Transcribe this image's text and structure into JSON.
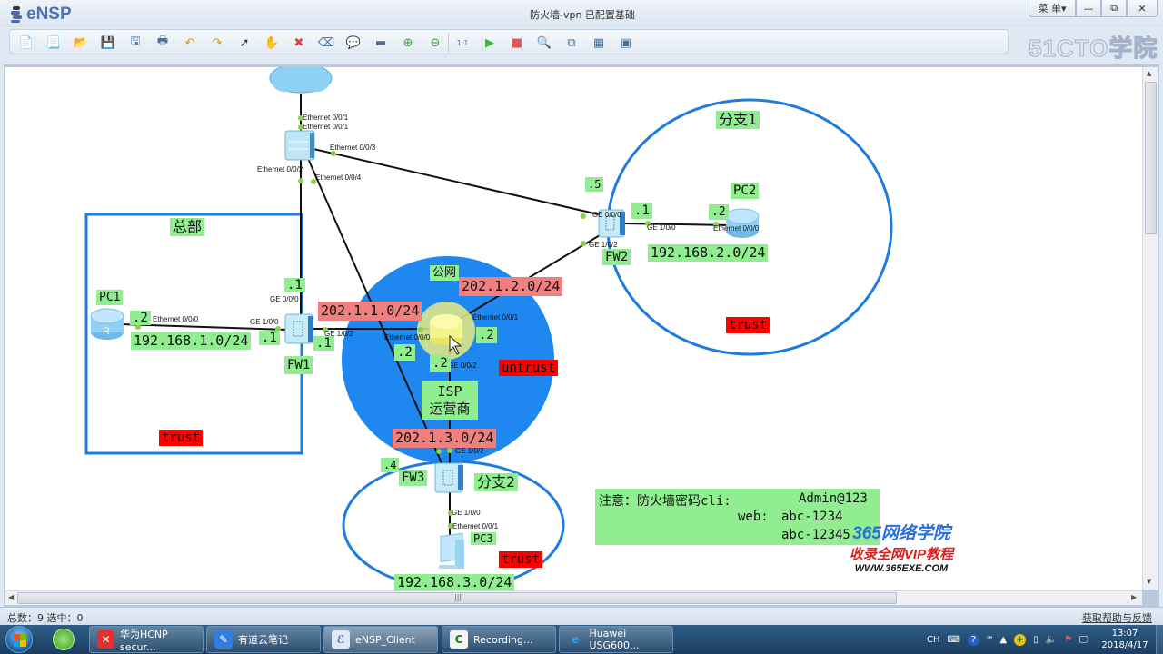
{
  "app": {
    "logo_text": "eNSP",
    "window_title": "防火墙-vpn 已配置基础",
    "menu_label": "菜 单▾",
    "min_label": "—",
    "max_label": "⧉",
    "close_label": "✕",
    "watermark": "51CTO学院"
  },
  "toolbar": {
    "items": [
      {
        "name": "new-topology",
        "glyph": "📄"
      },
      {
        "name": "new-example",
        "glyph": "📃"
      },
      {
        "name": "open",
        "glyph": "📂"
      },
      {
        "name": "save",
        "glyph": "💾"
      },
      {
        "name": "save-as",
        "glyph": "🖫"
      },
      {
        "name": "print",
        "glyph": "🖶"
      },
      {
        "name": "undo",
        "glyph": "↶"
      },
      {
        "name": "redo",
        "glyph": "↷"
      },
      {
        "name": "select",
        "glyph": "➚"
      },
      {
        "name": "pan",
        "glyph": "✋"
      },
      {
        "name": "delete",
        "glyph": "✖"
      },
      {
        "name": "delete-link",
        "glyph": "⌫"
      },
      {
        "name": "text-note",
        "glyph": "💬"
      },
      {
        "name": "palette",
        "glyph": "▬"
      },
      {
        "name": "zoom-in",
        "glyph": "⊕"
      },
      {
        "name": "zoom-out",
        "glyph": "⊖"
      },
      {
        "name": "fit",
        "glyph": "1:1"
      },
      {
        "name": "start-device",
        "glyph": "▶"
      },
      {
        "name": "stop-device",
        "glyph": "■"
      },
      {
        "name": "capture",
        "glyph": "🔍"
      },
      {
        "name": "topology",
        "glyph": "⧉"
      },
      {
        "name": "grid",
        "glyph": "▦"
      },
      {
        "name": "cli",
        "glyph": "▣"
      }
    ]
  },
  "topology": {
    "zones": {
      "hq": "总部",
      "branch1": "分支1",
      "branch2": "分支2",
      "public": "公网",
      "isp_line1": "ISP",
      "isp_line2": "运营商"
    },
    "devices": {
      "pc1": "PC1",
      "pc2": "PC2",
      "pc3": "PC3",
      "fw1": "FW1",
      "fw2": "FW2",
      "fw3": "FW3"
    },
    "subnets": {
      "lan1": "192.168.1.0/24",
      "lan2": "192.168.2.0/24",
      "lan3": "192.168.3.0/24",
      "wan1": "202.1.1.0/24",
      "wan2": "202.1.2.0/24",
      "wan3": "202.1.3.0/24"
    },
    "security_zones": {
      "hq_trust": "trust",
      "b1_trust": "trust",
      "b2_trust": "trust",
      "isp_untrust": "untrust"
    },
    "host_ids": {
      "pc1": ".2",
      "fw1_lan": ".1",
      "fw1_wan": ".1",
      "fw1_mgmt": ".1",
      "isp_w1": ".2",
      "isp_w2": ".2",
      "isp_w3": ".2",
      "fw2_wan_mgmt": ".5",
      "fw2_lan": ".1",
      "pc2": ".2",
      "fw3_mgmt": ".4"
    },
    "ports": {
      "cloud_sw": "Ethernet 0/0/1",
      "sw_cloud": "Ethernet 0/0/1",
      "sw_fw2": "Ethernet 0/0/3",
      "sw_fw1": "Ethernet 0/0/2",
      "sw_fw3": "Ethernet 0/0/4",
      "fw1_mgmt": "GE 0/0/0",
      "fw1_lan": "GE 1/0/0",
      "fw1_wan": "GE 1/0/2",
      "pc1_eth": "Ethernet 0/0/0",
      "isp_e0": "Ethernet 0/0/0",
      "isp_e1": "Ethernet 0/0/1",
      "isp_ge2": "GE 0/0/2",
      "fw2_mgmt": "GE 0/0/0",
      "fw2_wan": "GE 1/0/2",
      "fw2_lan": "GE 1/0/0",
      "pc2_eth": "Ethernet 0/0/0",
      "fw3_wan": "GE 1/0/2",
      "fw3_lan": "GE 1/0/0",
      "pc3_eth": "Ethernet 0/0/1"
    }
  },
  "note": {
    "line1_prefix": "注意：防火墙密码cli:",
    "line1_value": "Admin@123",
    "line2_prefix": "web:",
    "line2_value": "abc-1234",
    "line3_value": "abc-12345"
  },
  "watermark365": {
    "line1": "365网络学院",
    "line2": "收录全网VIP教程",
    "line3": "WWW.365EXE.COM"
  },
  "statusbar": {
    "left": "总数：9  选中：0",
    "right": "获取帮助与反馈"
  },
  "taskbar": {
    "tasks": [
      {
        "label": "华为HCNP secur...",
        "icon": "x-icon",
        "glyph": "✕"
      },
      {
        "label": "有道云笔记",
        "icon": "note-icon",
        "glyph": "✎"
      },
      {
        "label": "eNSP_Client",
        "icon": "ensp-icon",
        "glyph": "ℰ"
      },
      {
        "label": "Recording...",
        "icon": "camtasia-icon",
        "glyph": "C"
      },
      {
        "label": "Huawei USG600...",
        "icon": "ie-icon",
        "glyph": "e"
      }
    ],
    "tray": {
      "lang": "CH",
      "time": "13:07",
      "date": "2018/4/17"
    }
  }
}
